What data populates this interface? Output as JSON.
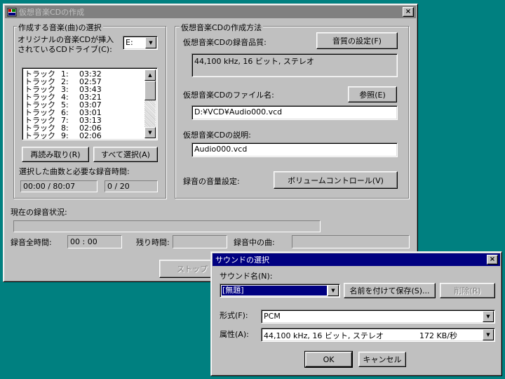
{
  "main_window": {
    "title": "仮想音楽CDの作成",
    "close_glyph": "×",
    "left_group": {
      "label": "作成する音楽(曲)の選択",
      "drive_label_line1": "オリジナルの音楽CDが挿入",
      "drive_label_line2": "されているCDドライブ(C):",
      "drive_value": "E:",
      "tracks": [
        {
          "name": "トラック",
          "num": "1:",
          "time": "03:32"
        },
        {
          "name": "トラック",
          "num": "2:",
          "time": "02:57"
        },
        {
          "name": "トラック",
          "num": "3:",
          "time": "03:43"
        },
        {
          "name": "トラック",
          "num": "4:",
          "time": "03:21"
        },
        {
          "name": "トラック",
          "num": "5:",
          "time": "03:07"
        },
        {
          "name": "トラック",
          "num": "6:",
          "time": "03:01"
        },
        {
          "name": "トラック",
          "num": "7:",
          "time": "03:13"
        },
        {
          "name": "トラック",
          "num": "8:",
          "time": "02:06"
        },
        {
          "name": "トラック",
          "num": "9:",
          "time": "02:06"
        }
      ],
      "reread_button": "再読み取り(R)",
      "select_all_button": "すべて選択(A)",
      "selected_label": "選択した曲数と必要な録音時間:",
      "selected_time": "00:00 / 80:07",
      "selected_count": "0 / 20"
    },
    "right_group": {
      "label": "仮想音楽CDの作成方法",
      "quality_label": "仮想音楽CDの録音品質:",
      "quality_button": "音質の設定(F)",
      "quality_value": "44,100 kHz, 16 ビット, ステレオ",
      "filename_label": "仮想音楽CDのファイル名:",
      "browse_button": "参照(E)",
      "filename_value": "D:¥VCD¥Audio000.vcd",
      "desc_label": "仮想音楽CDの説明:",
      "desc_value": "Audio000.vcd",
      "volume_label": "録音の音量設定:",
      "volume_button": "ボリュームコントロール(V)"
    },
    "status": {
      "label": "現在の録音状況:",
      "total_time_label": "録音全時間:",
      "total_time_value": "00 : 00",
      "remaining_label": "残り時間:",
      "remaining_value": "",
      "current_song_label": "録音中の曲:",
      "current_song_value": "",
      "stop_button": "ストップ"
    }
  },
  "sound_dialog": {
    "title": "サウンドの選択",
    "close_glyph": "×",
    "sound_name_label": "サウンド名(N):",
    "sound_name_value": "[無題]",
    "save_as_button": "名前を付けて保存(S)...",
    "delete_button": "削除(R)",
    "format_label": "形式(F):",
    "format_value": "PCM",
    "attributes_label": "属性(A):",
    "attributes_value": "44,100 kHz, 16 ビット, ステレオ",
    "attributes_rate": "172 KB/秒",
    "ok_button": "OK",
    "cancel_button": "キャンセル"
  }
}
